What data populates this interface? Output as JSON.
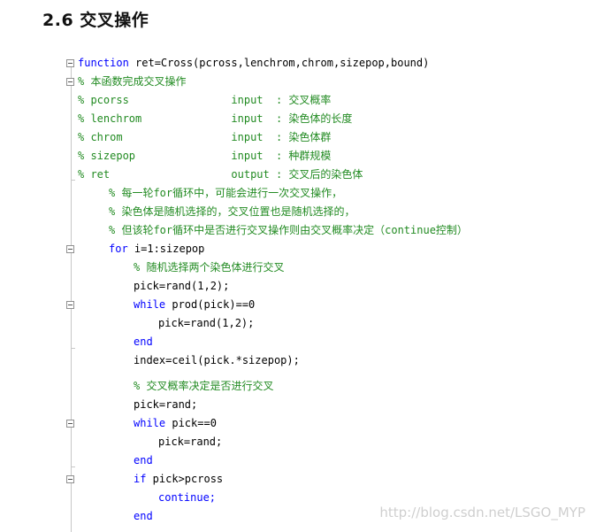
{
  "heading": "2.6 交叉操作",
  "code": {
    "l1_kw": "function",
    "l1_rest": " ret=Cross(pcross,lenchrom,chrom,sizepop,bound)",
    "l2": "% 本函数完成交叉操作",
    "l3": "% pcorss                input  : 交叉概率",
    "l4": "% lenchrom              input  : 染色体的长度",
    "l5": "% chrom                 input  : 染色体群",
    "l6": "% sizepop               input  : 种群规模",
    "l7": "% ret                   output : 交叉后的染色体",
    "l8": "% 每一轮for循环中，可能会进行一次交叉操作，",
    "l9": "% 染色体是随机选择的，交叉位置也是随机选择的，",
    "l10": "% 但该轮for循环中是否进行交叉操作则由交叉概率决定（continue控制）",
    "l11_kw": "for",
    "l11_rest": " i=1:sizepop",
    "l12": "% 随机选择两个染色体进行交叉",
    "l13": "pick=rand(1,2);",
    "l14_kw": "while",
    "l14_rest": " prod(pick)==0",
    "l15": "pick=rand(1,2);",
    "l16_kw": "end",
    "l17": "index=ceil(pick.*sizepop);",
    "l18": "% 交叉概率决定是否进行交叉",
    "l19": "pick=rand;",
    "l20_kw": "while",
    "l20_rest": " pick==0",
    "l21": "pick=rand;",
    "l22_kw": "end",
    "l23_kw": "if",
    "l23_rest": " pick>pcross",
    "l24_kw": "continue;",
    "l25_kw": "end"
  },
  "watermark": "http://blog.csdn.net/LSGO_MYP",
  "colors": {
    "keyword": "#0000ff",
    "comment": "#228b22",
    "text": "#000000"
  }
}
